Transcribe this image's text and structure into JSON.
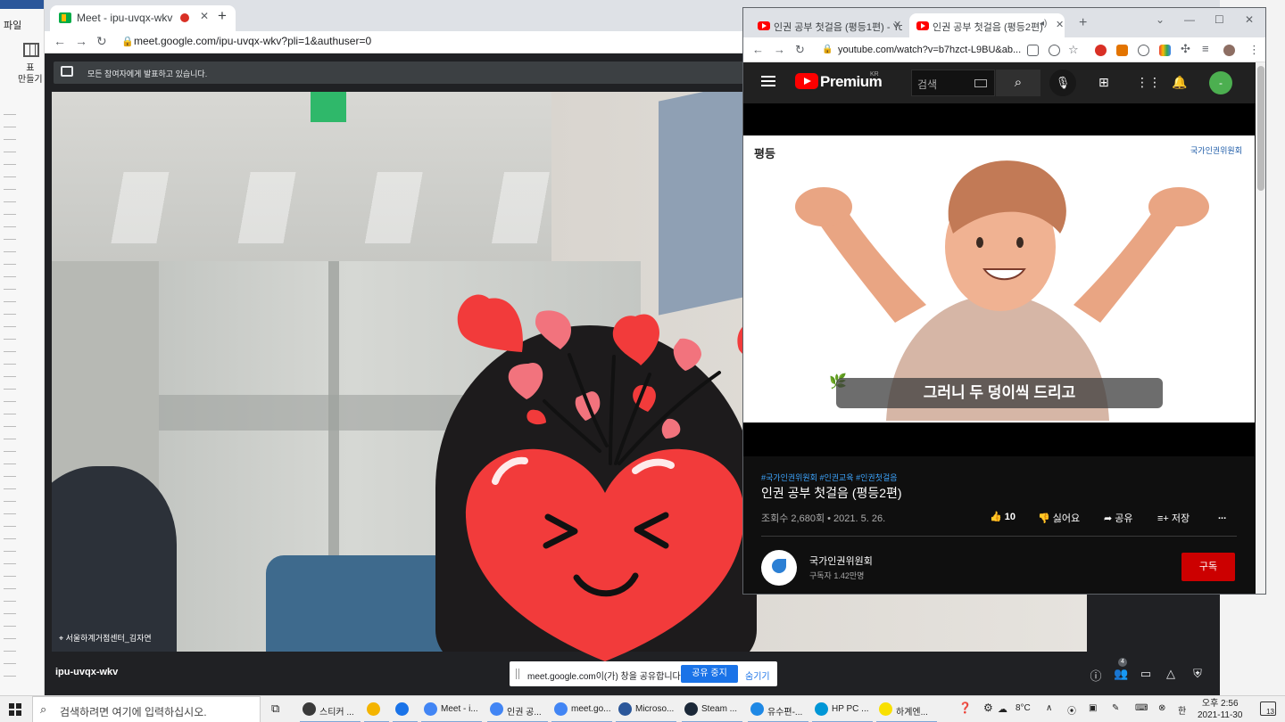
{
  "word": {
    "file_menu": "파일",
    "table_label_1": "표",
    "table_label_2": "만들기"
  },
  "meet": {
    "tab_title": "Meet - ipu-uvqx-wkv",
    "url": "meet.google.com/ipu-uvqx-wkv?pli=1&authuser=0",
    "presenting_banner": "모든 참여자에게 발표하고 있습니다.",
    "participant_name": "서울하계거점센터_김자연",
    "meeting_code": "ipu-uvqx-wkv",
    "people_count": "4",
    "share_bar": {
      "text": "meet.google.com이(가) 창을 공유합니다.",
      "stop": "공유 중지",
      "hide": "숨기기"
    }
  },
  "youtube": {
    "tab1_title": "인권 공부 첫걸음 (평등1편) - Yo",
    "tab2_title": "인권 공부 첫걸음 (평등2편)",
    "url": "youtube.com/watch?v=b7hzct-L9BU&ab...",
    "logo_text": "Premium",
    "region": "KR",
    "search_placeholder": "검색",
    "avatar_letter": "-",
    "video": {
      "corner_logo": "평등",
      "corner_org": "국가인권위원회",
      "subtitle": "그러니 두 덩이씩 드리고"
    },
    "hashtags": "#국가인권위원회 #인권교육 #인권첫걸음",
    "title": "인권 공부 첫걸음 (평등2편)",
    "views": "조회수 2,680회 • 2021. 5. 26.",
    "likes": "10",
    "dislike_label": "싫어요",
    "share_label": "공유",
    "save_label": "저장",
    "more_label": "...",
    "channel_name": "국가인권위원회",
    "subscribers": "구독자 1.42만명",
    "subscribe_label": "구독"
  },
  "taskbar": {
    "search_placeholder": "검색하려면 여기에 입력하십시오.",
    "items": [
      {
        "label": "스티커 ...",
        "color": "#3a3a3a"
      },
      {
        "label": "",
        "color": "#f4b400"
      },
      {
        "label": "",
        "color": "#1a73e8"
      },
      {
        "label": "Meet - i...",
        "color": "#4285f4"
      },
      {
        "label": "인권 공...",
        "color": "#4285f4"
      },
      {
        "label": "meet.go...",
        "color": "#4285f4"
      },
      {
        "label": "Microso...",
        "color": "#2b579a"
      },
      {
        "label": "Steam ...",
        "color": "#1b2838"
      },
      {
        "label": "유수편-...",
        "color": "#1e88e5"
      },
      {
        "label": "HP PC ...",
        "color": "#0096d6"
      },
      {
        "label": "하계엔...",
        "color": "#f9e000"
      }
    ],
    "temperature": "8°C",
    "ime": "한",
    "time": "오후 2:56",
    "date": "2021-11-30",
    "notifications": "13"
  }
}
